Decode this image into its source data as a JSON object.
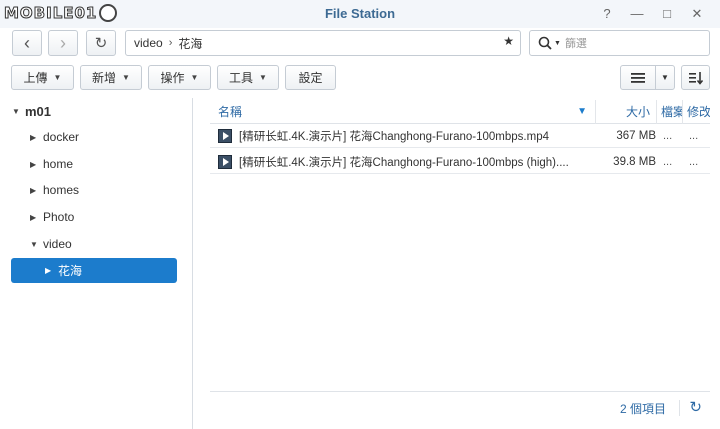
{
  "logo": {
    "text": "MOBILE01"
  },
  "window": {
    "title": "File Station",
    "help": "?",
    "minimize": "—",
    "maximize": "□",
    "close": "✕"
  },
  "nav": {
    "back": "‹",
    "forward": "›",
    "refresh": "↻"
  },
  "path": {
    "segments": [
      "video",
      "花海"
    ],
    "separator": "›",
    "star": "★"
  },
  "search": {
    "placeholder": "篩選"
  },
  "toolbar": {
    "upload": "上傳",
    "create": "新增",
    "action": "操作",
    "tools": "工具",
    "settings": "設定"
  },
  "tree": {
    "root": "m01",
    "items": [
      "docker",
      "home",
      "homes",
      "Photo",
      "video"
    ],
    "selected": "花海"
  },
  "list": {
    "headers": {
      "name": "名稱",
      "size": "大小",
      "type": "檔案",
      "modified": "修改"
    },
    "rows": [
      {
        "name": "[精研长虹.4K.演示片] 花海Changhong-Furano-100mbps.mp4",
        "size": "367 MB",
        "type": "...",
        "modified": "..."
      },
      {
        "name": "[精研长虹.4K.演示片] 花海Changhong-Furano-100mbps (high)....",
        "size": "39.8 MB",
        "type": "...",
        "modified": "..."
      }
    ]
  },
  "status": {
    "count": "2 個項目"
  },
  "colors": {
    "accent": "#1c7ccc",
    "header_text": "#2e6aa5",
    "title": "#3d6a93"
  }
}
